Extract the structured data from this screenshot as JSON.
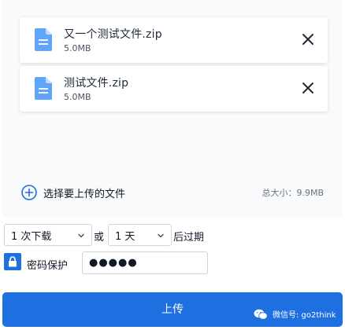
{
  "files": [
    {
      "name": "又一个测试文件.zip",
      "size": "5.0MB",
      "icon": "document-icon"
    },
    {
      "name": "测试文件.zip",
      "size": "5.0MB",
      "icon": "document-icon"
    }
  ],
  "add_files": {
    "label": "选择要上传的文件",
    "icon": "plus-circle-icon"
  },
  "total_size": "总大小：9.9MB",
  "download_limit": {
    "selected": "1 次下载"
  },
  "or_label": "或",
  "expiry": {
    "selected": "1 天"
  },
  "expire_label": "后过期",
  "password": {
    "label": "密码保护",
    "value": "●●●●●"
  },
  "upload_button": {
    "label": "上传"
  },
  "watermark": {
    "text": "微信号: go2think"
  },
  "colors": {
    "accent": "#1e6fe0",
    "file_icon": "#60a5fa",
    "panel_bg": "#f9fafb"
  }
}
